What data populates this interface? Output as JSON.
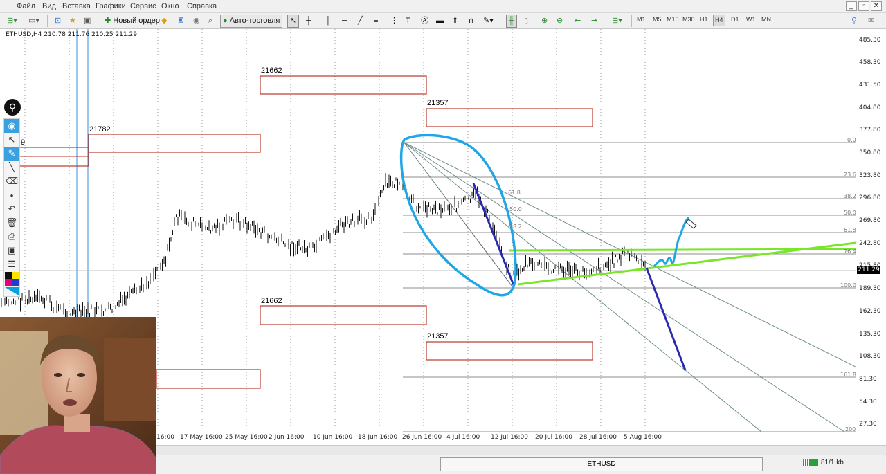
{
  "menu": [
    "Файл",
    "Вид",
    "Вставка",
    "Графики",
    "Сервис",
    "Окно",
    "Справка"
  ],
  "window_controls": [
    "_",
    "▫",
    "✕"
  ],
  "toolbar": {
    "new_order": "Новый ордер",
    "auto_trading": "Авто-торговля",
    "timeframes": [
      "M1",
      "M5",
      "M15",
      "M30",
      "H1",
      "H4",
      "D1",
      "W1",
      "MN"
    ],
    "active_timeframe": "H4"
  },
  "chart": {
    "symbol_info": "ETHUSD,H4  210.78 211.76 210.25 211.29",
    "current_price": "211.29",
    "price_ticks": [
      "485.30",
      "458.30",
      "431.50",
      "404.80",
      "377.80",
      "350.80",
      "323.80",
      "296.80",
      "269.80",
      "242.80",
      "215.80",
      "189.30",
      "162.30",
      "135.30",
      "108.30",
      "81.30",
      "54.30",
      "27.30"
    ],
    "date_ticks": [
      "16:00",
      "17 May 16:00",
      "25 May 16:00",
      "2 Jun 16:00",
      "10 Jun 16:00",
      "18 Jun 16:00",
      "26 Jun 16:00",
      "4 Jul 16:00",
      "12 Jul 16:00",
      "20 Jul 16:00",
      "28 Jul 16:00",
      "5 Aug 16:00"
    ],
    "zones": [
      "21662",
      "21357",
      "21782",
      "21662",
      "21357",
      "9"
    ],
    "fib_levels": [
      "0.0",
      "23.6",
      "38.2",
      "50.0",
      "61.8",
      "76.4",
      "100.0",
      "161.8",
      "200"
    ],
    "fan_labels": [
      "61.8",
      "50.0",
      "38.2"
    ]
  },
  "palette": [
    "cursor-icon",
    "eye-icon",
    "select-arrow-icon",
    "pencil-icon",
    "line-icon",
    "eraser-icon",
    "dot-icon",
    "undo-icon",
    "trash-icon",
    "print-icon",
    "screenshot-icon",
    "list-icon",
    "color-palette-icon"
  ],
  "status": {
    "tab": "ETHUSD",
    "traffic": "81/1 kb"
  }
}
